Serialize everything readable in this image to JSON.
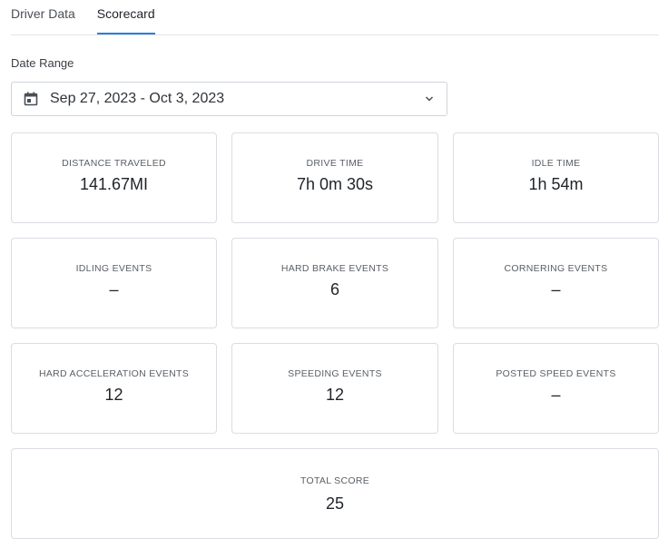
{
  "tabs": [
    {
      "label": "Driver Data"
    },
    {
      "label": "Scorecard"
    }
  ],
  "date_range": {
    "label": "Date Range",
    "value": "Sep 27, 2023 - Oct 3, 2023",
    "icon": "calendar-icon",
    "dropdown_icon": "chevron-down-icon"
  },
  "cards": [
    {
      "label": "DISTANCE TRAVELED",
      "value": "141.67MI"
    },
    {
      "label": "DRIVE TIME",
      "value": "7h 0m 30s"
    },
    {
      "label": "IDLE TIME",
      "value": "1h 54m"
    },
    {
      "label": "IDLING EVENTS",
      "value": "–"
    },
    {
      "label": "HARD BRAKE EVENTS",
      "value": "6"
    },
    {
      "label": "CORNERING EVENTS",
      "value": "–"
    },
    {
      "label": "HARD ACCELERATION EVENTS",
      "value": "12"
    },
    {
      "label": "SPEEDING EVENTS",
      "value": "12"
    },
    {
      "label": "POSTED SPEED EVENTS",
      "value": "–"
    }
  ],
  "total_score": {
    "label": "TOTAL SCORE",
    "value": "25"
  },
  "colors": {
    "accent": "#2a7de1",
    "border": "#d9dde2"
  }
}
